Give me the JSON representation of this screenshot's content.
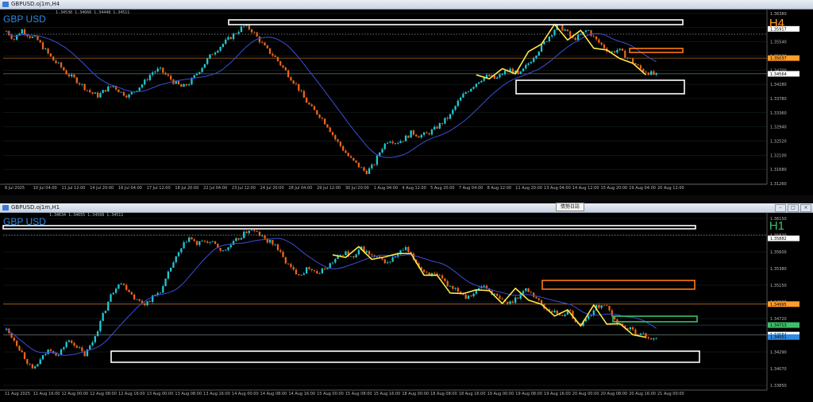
{
  "windows": {
    "top_title": "GBPUSD.oj1m,H4",
    "bottom_title": "GBPUSD.oj1m,H1",
    "tooltip": "情勢日誌"
  },
  "chart_data": [
    {
      "type": "candlestick",
      "symbol": "GBP USD",
      "timeframe": "H4",
      "ohlc_readout": "1.34538 1.34666 1.34448 1.34511",
      "ylim": [
        1.3126,
        1.3638
      ],
      "y_ticks": [
        "1.36380",
        "1.35960",
        "1.35540",
        "1.35120",
        "1.34700",
        "1.34280",
        "1.33780",
        "1.33360",
        "1.32940",
        "1.32520",
        "1.32100",
        "1.31680",
        "1.31260"
      ],
      "x_ticks": [
        "8 Jul 2025",
        "10 Jul 04:00",
        "11 Jul 12:00",
        "14 Jul 20:00",
        "16 Jul 04:00",
        "17 Jul 12:00",
        "18 Jul 20:00",
        "22 Jul 04:00",
        "23 Jul 12:00",
        "24 Jul 20:00",
        "28 Jul 04:00",
        "29 Jul 12:00",
        "30 Jul 20:00",
        "1 Aug 04:00",
        "4 Aug 12:00",
        "5 Aug 20:00",
        "7 Aug 04:00",
        "8 Aug 12:00",
        "11 Aug 20:00",
        "13 Aug 04:00",
        "14 Aug 12:00",
        "15 Aug 20:00",
        "19 Aug 04:00",
        "20 Aug 12:00"
      ],
      "price_labels": [
        {
          "value": 1.35917,
          "text": "1.35917",
          "color": "#ffffff"
        },
        {
          "value": 1.35037,
          "text": "1.35037",
          "color": "#ff9c2a"
        },
        {
          "value": 1.34564,
          "text": "1.34564",
          "color": "#ffffff"
        }
      ],
      "path": [
        1.3585,
        1.356,
        1.359,
        1.357,
        1.356,
        1.353,
        1.35,
        1.348,
        1.3455,
        1.344,
        1.342,
        1.34,
        1.339,
        1.341,
        1.342,
        1.34,
        1.339,
        1.341,
        1.343,
        1.346,
        1.347,
        1.345,
        1.343,
        1.3415,
        1.343,
        1.346,
        1.349,
        1.352,
        1.354,
        1.356,
        1.358,
        1.36,
        1.359,
        1.356,
        1.353,
        1.351,
        1.348,
        1.345,
        1.342,
        1.338,
        1.335,
        1.333,
        1.33,
        1.326,
        1.323,
        1.32,
        1.318,
        1.316,
        1.318,
        1.323,
        1.326,
        1.325,
        1.326,
        1.328,
        1.327,
        1.3275,
        1.329,
        1.331,
        1.333,
        1.337,
        1.34,
        1.342,
        1.344,
        1.345,
        1.344,
        1.346,
        1.347,
        1.345,
        1.348,
        1.351,
        1.354,
        1.357,
        1.36,
        1.359,
        1.356,
        1.357,
        1.359,
        1.356,
        1.354,
        1.352,
        1.353,
        1.351,
        1.349,
        1.347,
        1.346,
        1.3451
      ],
      "ma_label": "moving average"
    },
    {
      "type": "candlestick",
      "symbol": "GBP USD",
      "timeframe": "H1",
      "ohlc_readout": "1.34634 1.34655 1.34508 1.34511",
      "ylim": [
        1.339,
        1.3615
      ],
      "y_ticks": [
        "1.36150",
        "1.35820",
        "1.35600",
        "1.35380",
        "1.35150",
        "1.34930",
        "1.34720",
        "1.34500",
        "1.34290",
        "1.34070",
        "1.33850"
      ],
      "x_ticks": [
        "11 Aug 2025",
        "11 Aug 16:00",
        "12 Aug 00:00",
        "12 Aug 08:00",
        "12 Aug 16:00",
        "13 Aug 00:00",
        "13 Aug 08:00",
        "13 Aug 16:00",
        "14 Aug 00:00",
        "14 Aug 08:00",
        "14 Aug 16:00",
        "15 Aug 00:00",
        "15 Aug 08:00",
        "15 Aug 16:00",
        "18 Aug 00:00",
        "18 Aug 08:00",
        "18 Aug 16:00",
        "19 Aug 00:00",
        "19 Aug 08:00",
        "19 Aug 16:00",
        "20 Aug 00:00",
        "20 Aug 08:00",
        "20 Aug 16:00",
        "21 Aug 00:00"
      ],
      "price_labels": [
        {
          "value": 1.35882,
          "text": "1.35882",
          "color": "#ffffff"
        },
        {
          "value": 1.34995,
          "text": "1.34995",
          "color": "#ff9c2a"
        },
        {
          "value": 1.34713,
          "text": "1.34713",
          "color": "#3cc06a"
        },
        {
          "value": 1.34584,
          "text": "1.34584",
          "color": "#ffffff"
        },
        {
          "value": 1.34551,
          "text": "1.34551",
          "color": "#2f8ae0"
        }
      ],
      "path": [
        1.3465,
        1.345,
        1.343,
        1.341,
        1.3425,
        1.344,
        1.343,
        1.345,
        1.3445,
        1.343,
        1.345,
        1.348,
        1.351,
        1.353,
        1.352,
        1.3505,
        1.35,
        1.351,
        1.352,
        1.355,
        1.357,
        1.359,
        1.358,
        1.3585,
        1.358,
        1.357,
        1.358,
        1.359,
        1.36,
        1.3595,
        1.3585,
        1.358,
        1.356,
        1.3545,
        1.354,
        1.355,
        1.354,
        1.355,
        1.356,
        1.357,
        1.356,
        1.3575,
        1.3565,
        1.356,
        1.3555,
        1.3565,
        1.3575,
        1.356,
        1.3545,
        1.354,
        1.3535,
        1.3525,
        1.352,
        1.351,
        1.3515,
        1.3525,
        1.3515,
        1.3505,
        1.35,
        1.351,
        1.352,
        1.351,
        1.3495,
        1.349,
        1.3485,
        1.349,
        1.347,
        1.348,
        1.3495,
        1.35,
        1.348,
        1.347,
        1.3465,
        1.346,
        1.3455,
        1.3451
      ],
      "ma_label": "moving average"
    }
  ],
  "colors": {
    "bull": "#1fc9d3",
    "bear": "#e8641c",
    "ma": "#3b4fd6",
    "zigzag": "#ffe84a",
    "box_white": "#ffffff",
    "box_orange": "#ff7a14",
    "box_green": "#3cc06a",
    "orange_line": "#ff9c2a",
    "grid": "#1c2a2a"
  }
}
